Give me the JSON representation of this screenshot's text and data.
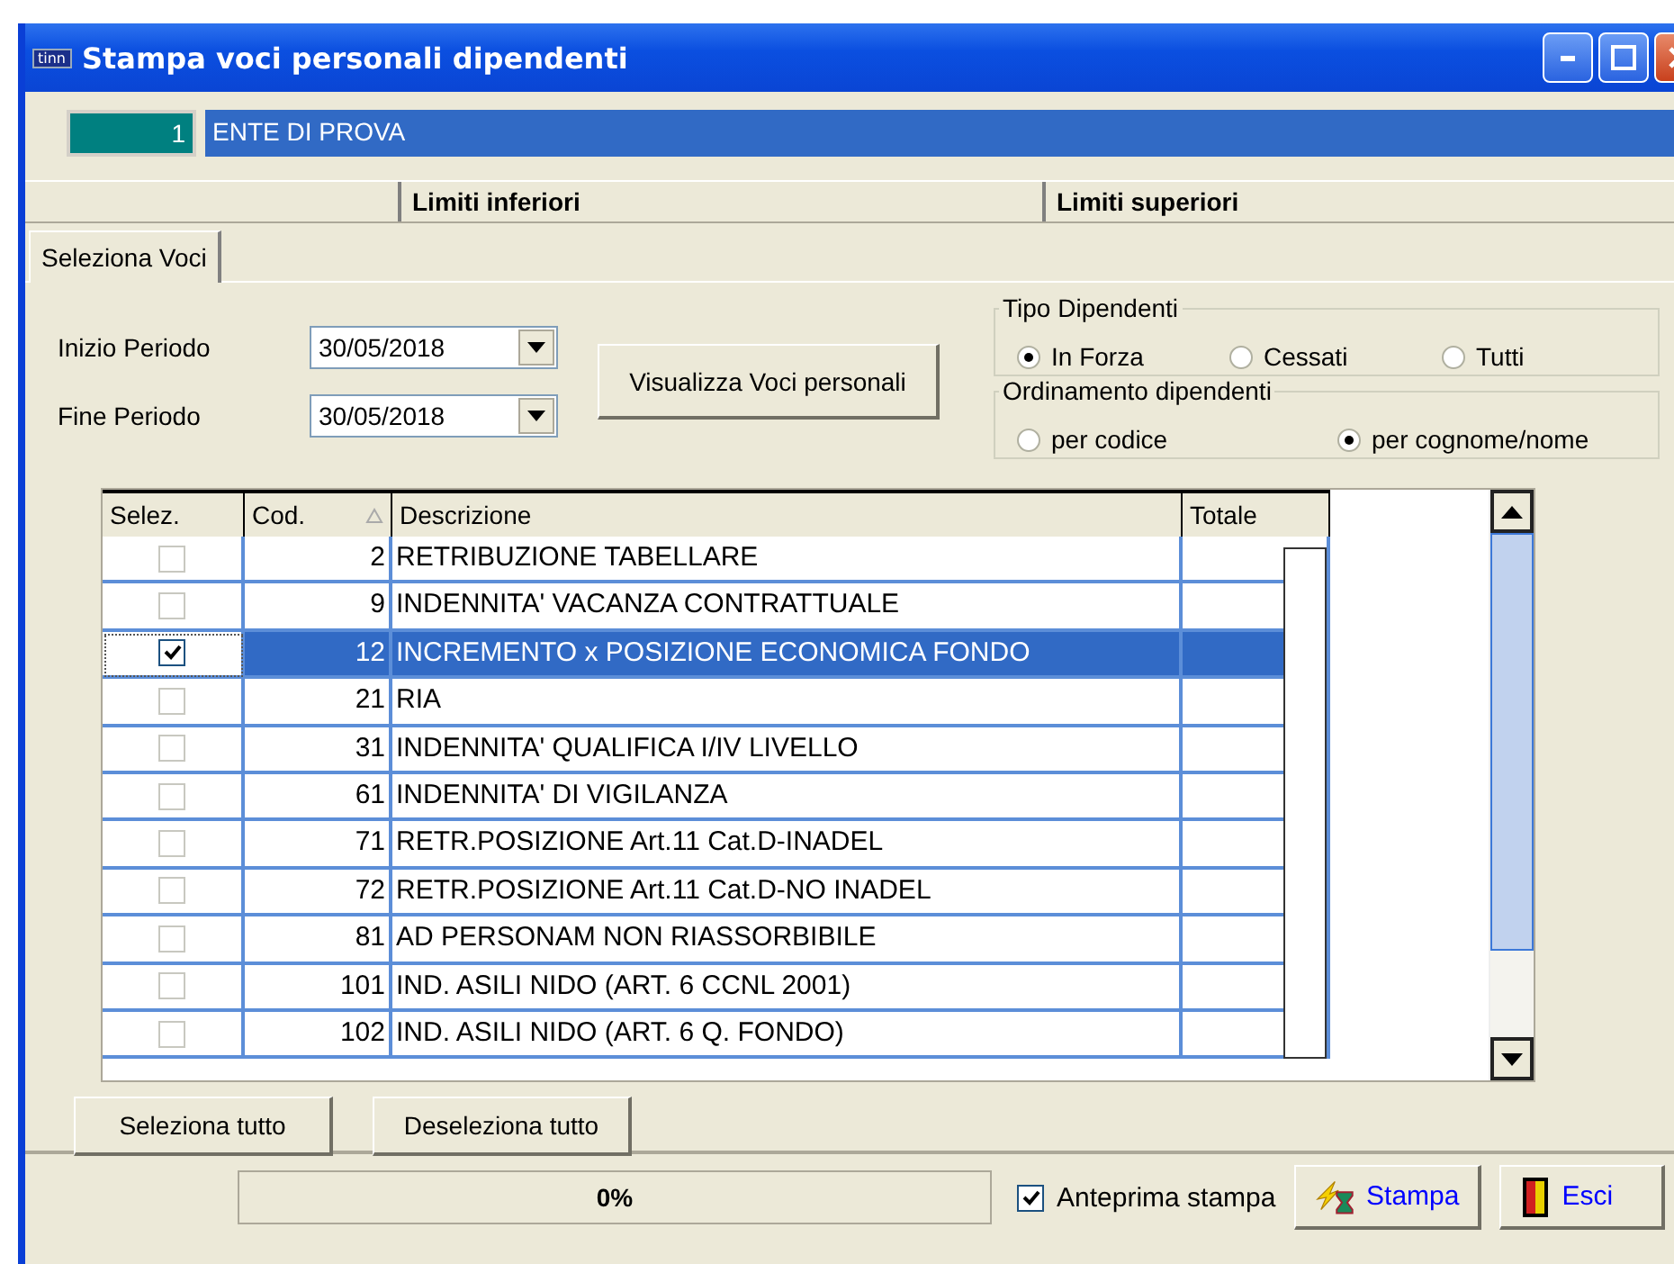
{
  "window": {
    "title": "Stampa voci personali dipendenti",
    "app_badge": "tinn"
  },
  "company": {
    "code": "1",
    "name": "ENTE DI PROVA"
  },
  "limits_header": [
    "Limiti inferiori",
    "Limiti superiori"
  ],
  "tabs": [
    {
      "label": "Seleziona Voci",
      "selected": true
    }
  ],
  "period": [
    {
      "label": "Inizio Periodo",
      "value": "30/05/2018"
    },
    {
      "label": "Fine Periodo",
      "value": "30/05/2018"
    }
  ],
  "show_button": "Visualizza Voci personali",
  "groups": [
    {
      "title": "Tipo Dipendenti",
      "options": [
        {
          "label": "In Forza",
          "selected": true
        },
        {
          "label": "Cessati",
          "selected": false
        },
        {
          "label": "Tutti",
          "selected": false
        }
      ]
    },
    {
      "title": "Ordinamento dipendenti",
      "options": [
        {
          "label": "per codice",
          "selected": false
        },
        {
          "label": "per cognome/nome",
          "selected": true
        }
      ]
    }
  ],
  "table": {
    "columns": [
      "Selez.",
      "Cod.",
      "Descrizione",
      "Totale"
    ],
    "rows": [
      {
        "checked": false,
        "selected": false,
        "code": "2",
        "description": "RETRIBUZIONE TABELLARE"
      },
      {
        "checked": false,
        "selected": false,
        "code": "9",
        "description": "INDENNITA' VACANZA CONTRATTUALE"
      },
      {
        "checked": true,
        "selected": true,
        "code": "12",
        "description": "INCREMENTO x POSIZIONE ECONOMICA FONDO"
      },
      {
        "checked": false,
        "selected": false,
        "code": "21",
        "description": "RIA"
      },
      {
        "checked": false,
        "selected": false,
        "code": "31",
        "description": "INDENNITA' QUALIFICA I/IV LIVELLO"
      },
      {
        "checked": false,
        "selected": false,
        "code": "61",
        "description": "INDENNITA' DI VIGILANZA"
      },
      {
        "checked": false,
        "selected": false,
        "code": "71",
        "description": "RETR.POSIZIONE Art.11 Cat.D-INADEL"
      },
      {
        "checked": false,
        "selected": false,
        "code": "72",
        "description": "RETR.POSIZIONE Art.11 Cat.D-NO INADEL"
      },
      {
        "checked": false,
        "selected": false,
        "code": "81",
        "description": "AD PERSONAM NON RIASSORBIBILE"
      },
      {
        "checked": false,
        "selected": false,
        "code": "101",
        "description": "IND. ASILI NIDO (ART. 6 CCNL 2001)"
      },
      {
        "checked": false,
        "selected": false,
        "code": "102",
        "description": "IND. ASILI NIDO (ART. 6 Q. FONDO)"
      }
    ]
  },
  "selection_buttons": [
    "Seleziona tutto",
    "Deseleziona tutto"
  ],
  "status": {
    "progress_text": "0%",
    "level": 0,
    "preview": {
      "label": "Anteprima stampa",
      "checked": true
    }
  },
  "actions": [
    {
      "kind": "print",
      "label": "Stampa"
    },
    {
      "kind": "exit",
      "label": "Esci"
    }
  ]
}
